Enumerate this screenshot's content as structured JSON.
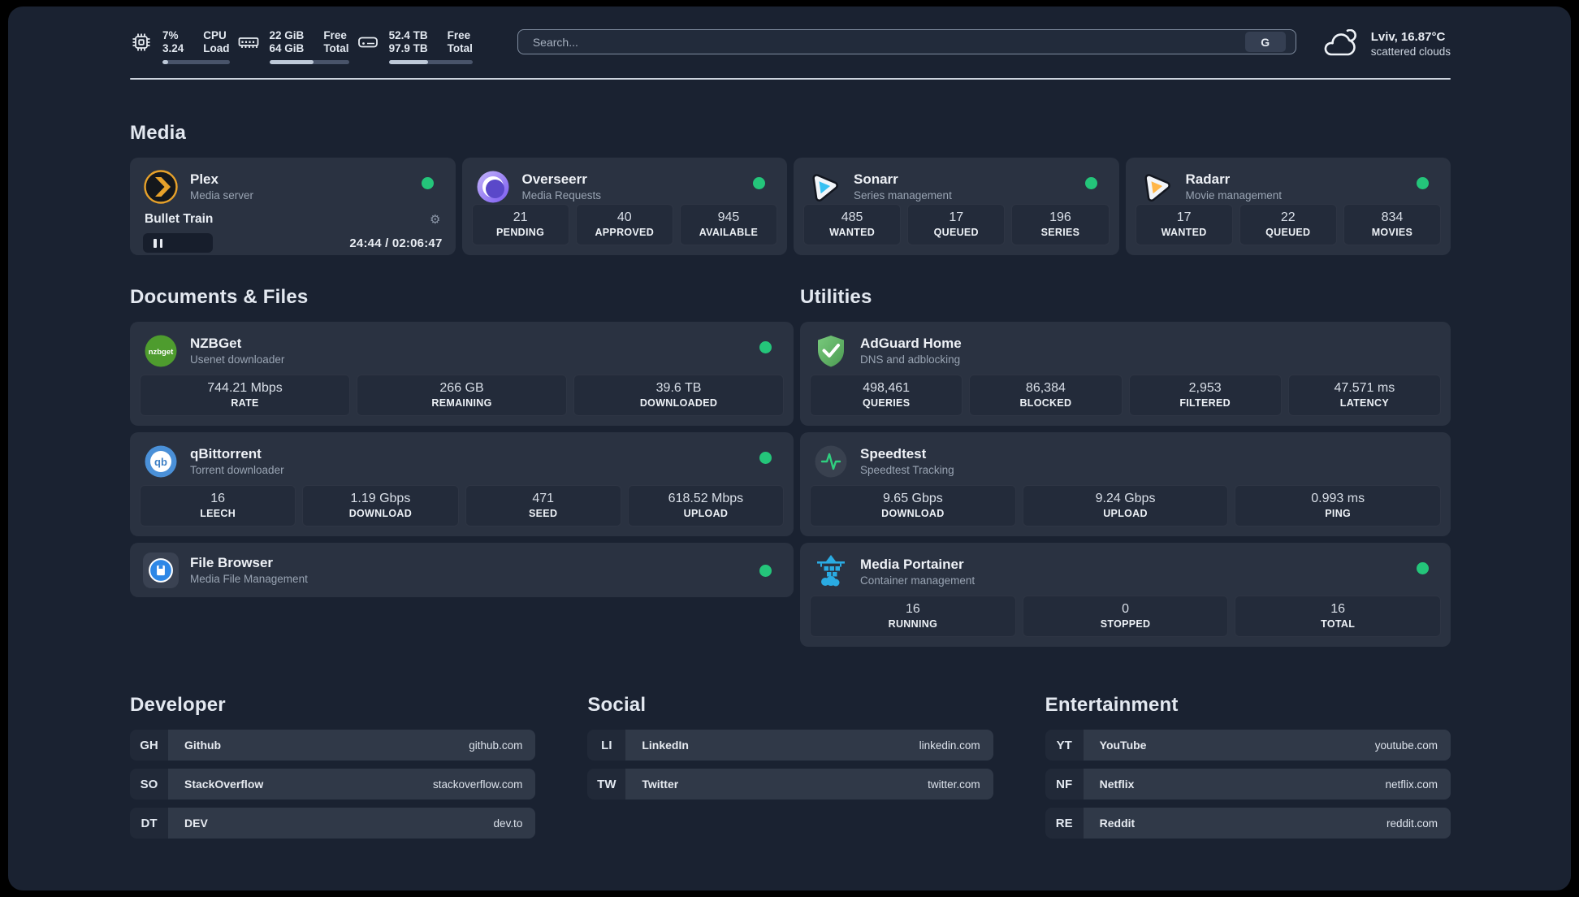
{
  "header": {
    "cpu": {
      "value1": "7%",
      "value2": "3.24",
      "label1": "CPU",
      "label2": "Load",
      "progress": 9
    },
    "ram": {
      "value1": "22 GiB",
      "value2": "64 GiB",
      "label1": "Free",
      "label2": "Total",
      "progress": 56
    },
    "disk": {
      "value1": "52.4 TB",
      "value2": "97.9 TB",
      "label1": "Free",
      "label2": "Total",
      "progress": 47
    },
    "search": {
      "placeholder": "Search...",
      "engine_button": "G"
    },
    "weather": {
      "title": "Lviv, 16.87°C",
      "subtitle": "scattered clouds"
    }
  },
  "sections": {
    "media": "Media",
    "docs": "Documents & Files",
    "utilities": "Utilities",
    "developer": "Developer",
    "social": "Social",
    "entertainment": "Entertainment"
  },
  "apps": {
    "plex": {
      "name": "Plex",
      "desc": "Media server",
      "status": "online",
      "now_playing": "Bullet Train",
      "time": "24:44 / 02:06:47"
    },
    "overseerr": {
      "name": "Overseerr",
      "desc": "Media Requests",
      "status": "online",
      "stats": [
        {
          "value": "21",
          "label": "PENDING"
        },
        {
          "value": "40",
          "label": "APPROVED"
        },
        {
          "value": "945",
          "label": "AVAILABLE"
        }
      ]
    },
    "sonarr": {
      "name": "Sonarr",
      "desc": "Series management",
      "status": "online",
      "stats": [
        {
          "value": "485",
          "label": "WANTED"
        },
        {
          "value": "17",
          "label": "QUEUED"
        },
        {
          "value": "196",
          "label": "SERIES"
        }
      ]
    },
    "radarr": {
      "name": "Radarr",
      "desc": "Movie management",
      "status": "online",
      "stats": [
        {
          "value": "17",
          "label": "WANTED"
        },
        {
          "value": "22",
          "label": "QUEUED"
        },
        {
          "value": "834",
          "label": "MOVIES"
        }
      ]
    },
    "nzbget": {
      "name": "NZBGet",
      "desc": "Usenet downloader",
      "status": "online",
      "stats": [
        {
          "value": "744.21 Mbps",
          "label": "RATE"
        },
        {
          "value": "266 GB",
          "label": "REMAINING"
        },
        {
          "value": "39.6 TB",
          "label": "DOWNLOADED"
        }
      ]
    },
    "qbittorrent": {
      "name": "qBittorrent",
      "desc": "Torrent downloader",
      "status": "online",
      "stats": [
        {
          "value": "16",
          "label": "LEECH"
        },
        {
          "value": "1.19 Gbps",
          "label": "DOWNLOAD"
        },
        {
          "value": "471",
          "label": "SEED"
        },
        {
          "value": "618.52 Mbps",
          "label": "UPLOAD"
        }
      ]
    },
    "filebrowser": {
      "name": "File Browser",
      "desc": "Media File Management",
      "status": "online"
    },
    "adguard": {
      "name": "AdGuard Home",
      "desc": "DNS and adblocking",
      "stats": [
        {
          "value": "498,461",
          "label": "QUERIES"
        },
        {
          "value": "86,384",
          "label": "BLOCKED"
        },
        {
          "value": "2,953",
          "label": "FILTERED"
        },
        {
          "value": "47.571 ms",
          "label": "LATENCY"
        }
      ]
    },
    "speedtest": {
      "name": "Speedtest",
      "desc": "Speedtest Tracking",
      "stats": [
        {
          "value": "9.65 Gbps",
          "label": "DOWNLOAD"
        },
        {
          "value": "9.24 Gbps",
          "label": "UPLOAD"
        },
        {
          "value": "0.993 ms",
          "label": "PING"
        }
      ]
    },
    "portainer": {
      "name": "Media Portainer",
      "desc": "Container management",
      "status": "online",
      "stats": [
        {
          "value": "16",
          "label": "RUNNING"
        },
        {
          "value": "0",
          "label": "STOPPED"
        },
        {
          "value": "16",
          "label": "TOTAL"
        }
      ]
    }
  },
  "links": {
    "developer": [
      {
        "abbr": "GH",
        "name": "Github",
        "url": "github.com"
      },
      {
        "abbr": "SO",
        "name": "StackOverflow",
        "url": "stackoverflow.com"
      },
      {
        "abbr": "DT",
        "name": "DEV",
        "url": "dev.to"
      }
    ],
    "social": [
      {
        "abbr": "LI",
        "name": "LinkedIn",
        "url": "linkedin.com"
      },
      {
        "abbr": "TW",
        "name": "Twitter",
        "url": "twitter.com"
      }
    ],
    "entertainment": [
      {
        "abbr": "YT",
        "name": "YouTube",
        "url": "youtube.com"
      },
      {
        "abbr": "NF",
        "name": "Netflix",
        "url": "netflix.com"
      },
      {
        "abbr": "RE",
        "name": "Reddit",
        "url": "reddit.com"
      }
    ]
  },
  "colors": {
    "status_online": "#24c57a",
    "panel_bg": "#1a2231",
    "card_bg": "#2a3241",
    "plex_gold": "#e8a22a",
    "sonarr_blue": "#38c1f2",
    "radarr_orange": "#ffb648",
    "overseerr_purple": "#8b72ea",
    "nzbget_green": "#4e9c2e",
    "qbittorrent_blue": "#4a90d8",
    "filebrowser_blue": "#2d87e6",
    "adguard_green": "#5fbc66",
    "speedtest_green": "#2fcf7f",
    "portainer_blue": "#2aabe2"
  }
}
